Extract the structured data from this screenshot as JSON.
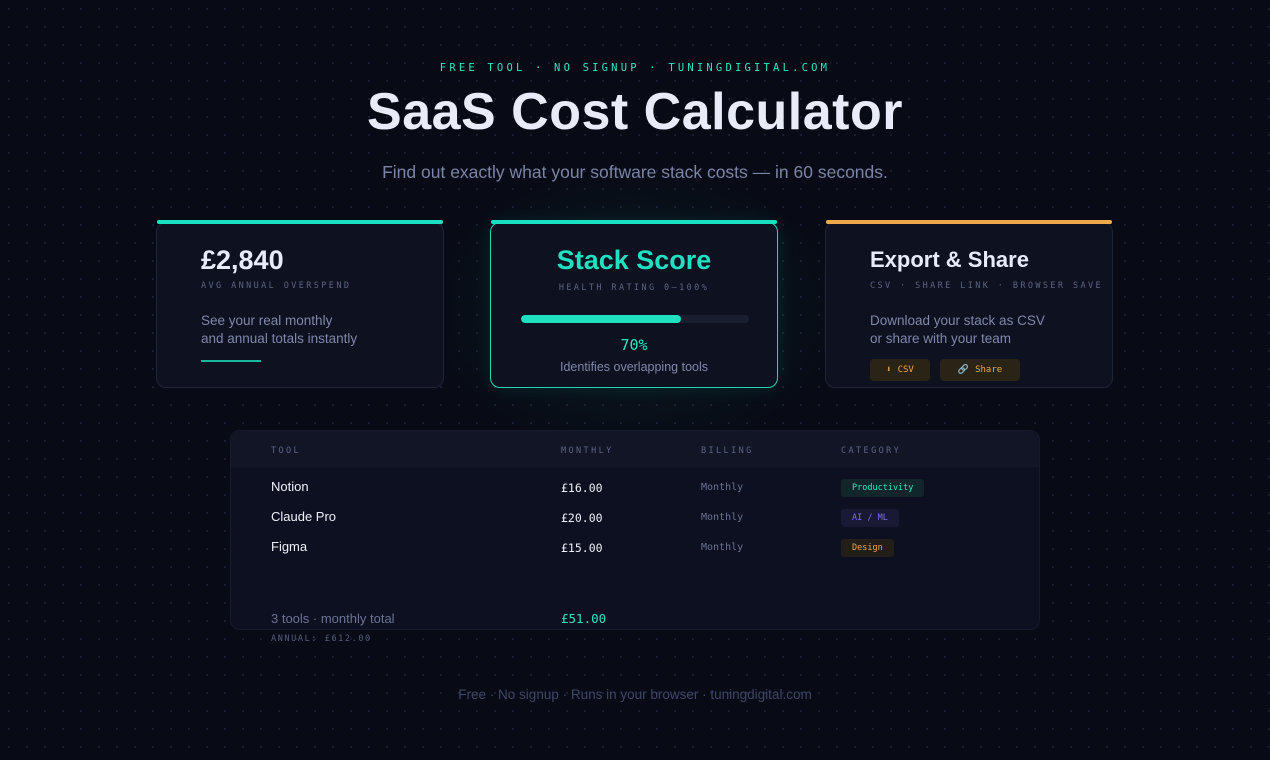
{
  "header": {
    "eyebrow": "FREE TOOL · NO SIGNUP · TUNINGDIGITAL.COM",
    "title": "SaaS Cost Calculator",
    "subtitle": "Find out exactly what your software stack costs — in 60 seconds."
  },
  "cards": {
    "overspend": {
      "value": "£2,840",
      "caption": "AVG ANNUAL OVERSPEND",
      "text_line1": "See your real monthly",
      "text_line2": "and annual totals instantly",
      "accent": "#19e0c0"
    },
    "score": {
      "title": "Stack Score",
      "caption": "HEALTH RATING 0–100%",
      "percent_label": "70%",
      "progress": 0.7,
      "subtext": "Identifies overlapping tools",
      "accent": "#19e0c0"
    },
    "export": {
      "title": "Export & Share",
      "caption": "CSV · SHARE LINK · BROWSER SAVE",
      "text_line1": "Download your stack as CSV",
      "text_line2": "or share with your team",
      "csv_icon": "⬇",
      "csv_icon_name": "download-icon",
      "csv_label": "CSV",
      "share_icon": "🔗",
      "share_icon_name": "link-icon",
      "share_label": "Share",
      "accent": "#f0a94a"
    }
  },
  "table": {
    "headers": {
      "tool": "TOOL",
      "monthly": "MONTHLY",
      "billing": "BILLING",
      "category": "CATEGORY"
    },
    "rows": [
      {
        "tool": "Notion",
        "monthly": "£16.00",
        "billing": "Monthly",
        "category": "Productivity",
        "category_color": "#2ee6c4",
        "category_bg": "#10262a"
      },
      {
        "tool": "Claude Pro",
        "monthly": "£20.00",
        "billing": "Monthly",
        "category": "AI / ML",
        "category_color": "#7b6cf0",
        "category_bg": "#1a1933"
      },
      {
        "tool": "Figma",
        "monthly": "£15.00",
        "billing": "Monthly",
        "category": "Design",
        "category_color": "#f0a94a",
        "category_bg": "#231e18"
      }
    ],
    "total_label": "3 tools · monthly total",
    "total_value": "£51.00",
    "annual": "ANNUAL: £612.00"
  },
  "footer": {
    "text": "Free · No signup · Runs in your browser · tuningdigital.com"
  }
}
